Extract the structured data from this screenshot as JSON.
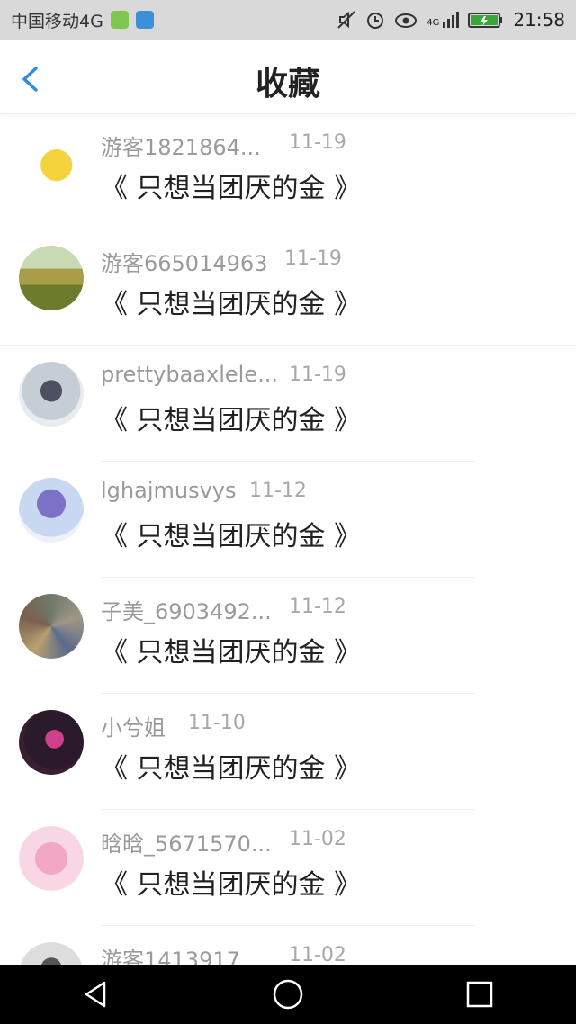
{
  "status_bar": {
    "carrier": "中国移动4G",
    "time": "21:58",
    "network": "4G",
    "icons": [
      "wechat-icon",
      "gallery-icon",
      "mute-icon",
      "alarm-icon",
      "eye-icon",
      "signal-icon",
      "battery-icon"
    ]
  },
  "header": {
    "title": "收藏",
    "back_icon": "chevron-left-icon"
  },
  "favorites": [
    {
      "user": "游客1821864...",
      "date": "11-19",
      "work": "《 只想当团厌的金 》"
    },
    {
      "user": "游客665014963",
      "date": "11-19",
      "work": "《 只想当团厌的金 》"
    },
    {
      "user": "prettybaaxlele...",
      "date": "11-19",
      "work": "《 只想当团厌的金 》"
    },
    {
      "user": "lghajmusvys",
      "date": "11-12",
      "work": "《 只想当团厌的金 》"
    },
    {
      "user": "子美_6903492...",
      "date": "11-12",
      "work": "《 只想当团厌的金 》"
    },
    {
      "user": "小兮姐",
      "date": "11-10",
      "work": "《 只想当团厌的金 》"
    },
    {
      "user": "晗晗_5671570...",
      "date": "11-02",
      "work": "《 只想当团厌的金 》"
    },
    {
      "user": "游客1413917...",
      "date": "11-02",
      "work": ""
    }
  ],
  "nav_bar": {
    "buttons": [
      "back-triangle-icon",
      "home-circle-icon",
      "recents-square-icon"
    ]
  },
  "colors": {
    "accent": "#2f8be6",
    "status_bar_bg": "#d9d9d9",
    "nav_bar_bg": "#000000"
  }
}
